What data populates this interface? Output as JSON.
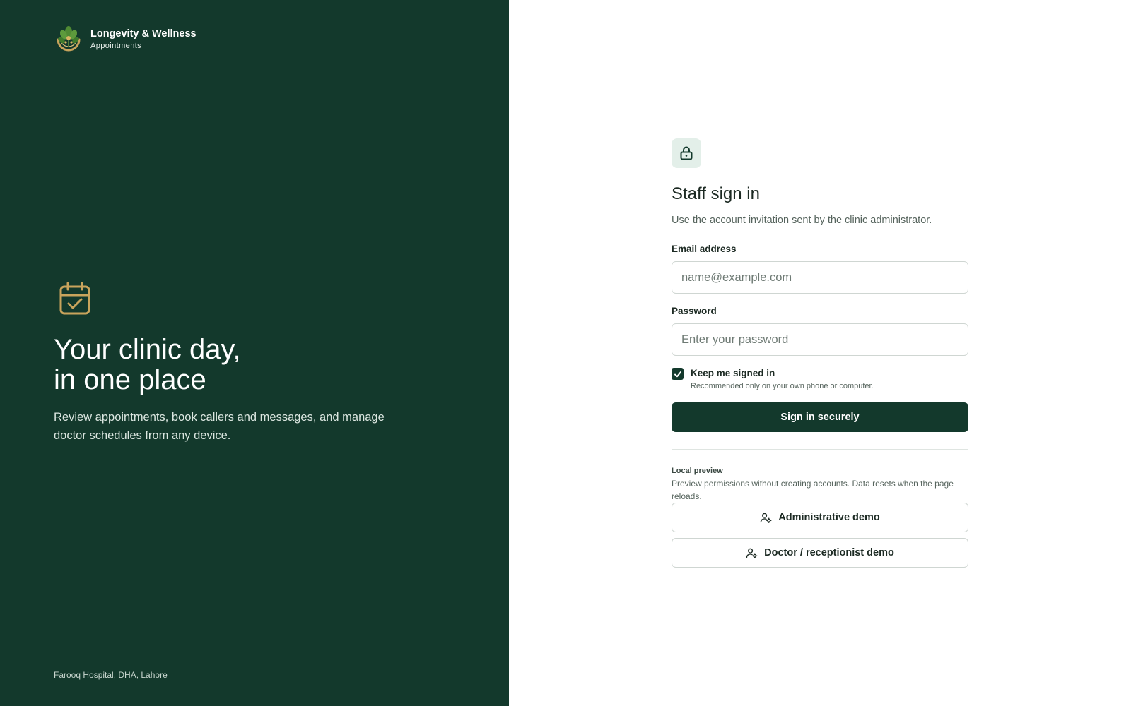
{
  "brand": {
    "name": "Longevity & Wellness",
    "subtitle": "Appointments"
  },
  "hero": {
    "icon": "calendar-check-icon",
    "title_line1": "Your clinic day,",
    "title_line2": "in one place",
    "description": "Review appointments, book callers and messages, and manage doctor schedules from any device."
  },
  "footer": {
    "location": "Farooq Hospital, DHA, Lahore"
  },
  "form": {
    "icon": "lock-icon",
    "title": "Staff sign in",
    "subtitle": "Use the account invitation sent by the clinic administrator.",
    "email": {
      "label": "Email address",
      "placeholder": "name@example.com",
      "value": ""
    },
    "password": {
      "label": "Password",
      "placeholder": "Enter your password",
      "value": ""
    },
    "remember": {
      "label": "Keep me signed in",
      "hint": "Recommended only on your own phone or computer.",
      "checked": true
    },
    "submit_label": "Sign in securely"
  },
  "preview": {
    "title": "Local preview",
    "description": "Preview permissions without creating accounts. Data resets when the page reloads.",
    "buttons": [
      {
        "label": "Administrative demo",
        "icon": "user-gear-icon"
      },
      {
        "label": "Doctor / receptionist demo",
        "icon": "user-gear-icon"
      }
    ]
  },
  "colors": {
    "brand_dark_green": "#13392c",
    "accent_gold": "#c9a45c",
    "badge_bg": "#e3efe9",
    "border": "#cfd6d2"
  }
}
